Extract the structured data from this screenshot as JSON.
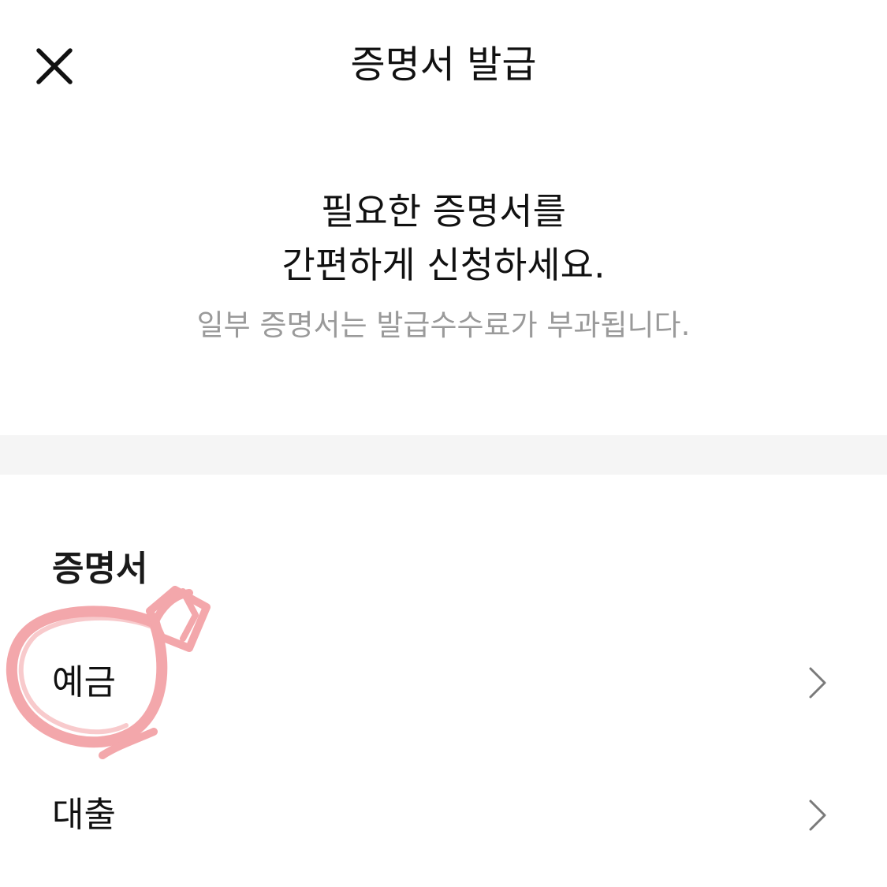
{
  "header": {
    "title": "증명서 발급",
    "close_icon": "close-icon"
  },
  "intro": {
    "line1": "필요한 증명서를",
    "line2": "간편하게 신청하세요.",
    "note": "일부 증명서는 발급수수료가 부과됩니다."
  },
  "section": {
    "title": "증명서",
    "items": [
      {
        "label": "예금",
        "icon": "chevron-right-icon"
      },
      {
        "label": "대출",
        "icon": "chevron-right-icon"
      }
    ]
  },
  "colors": {
    "text": "#111111",
    "subtext": "#9a9a9a",
    "divider": "#f5f5f5",
    "annotation": "#f08a8f"
  }
}
